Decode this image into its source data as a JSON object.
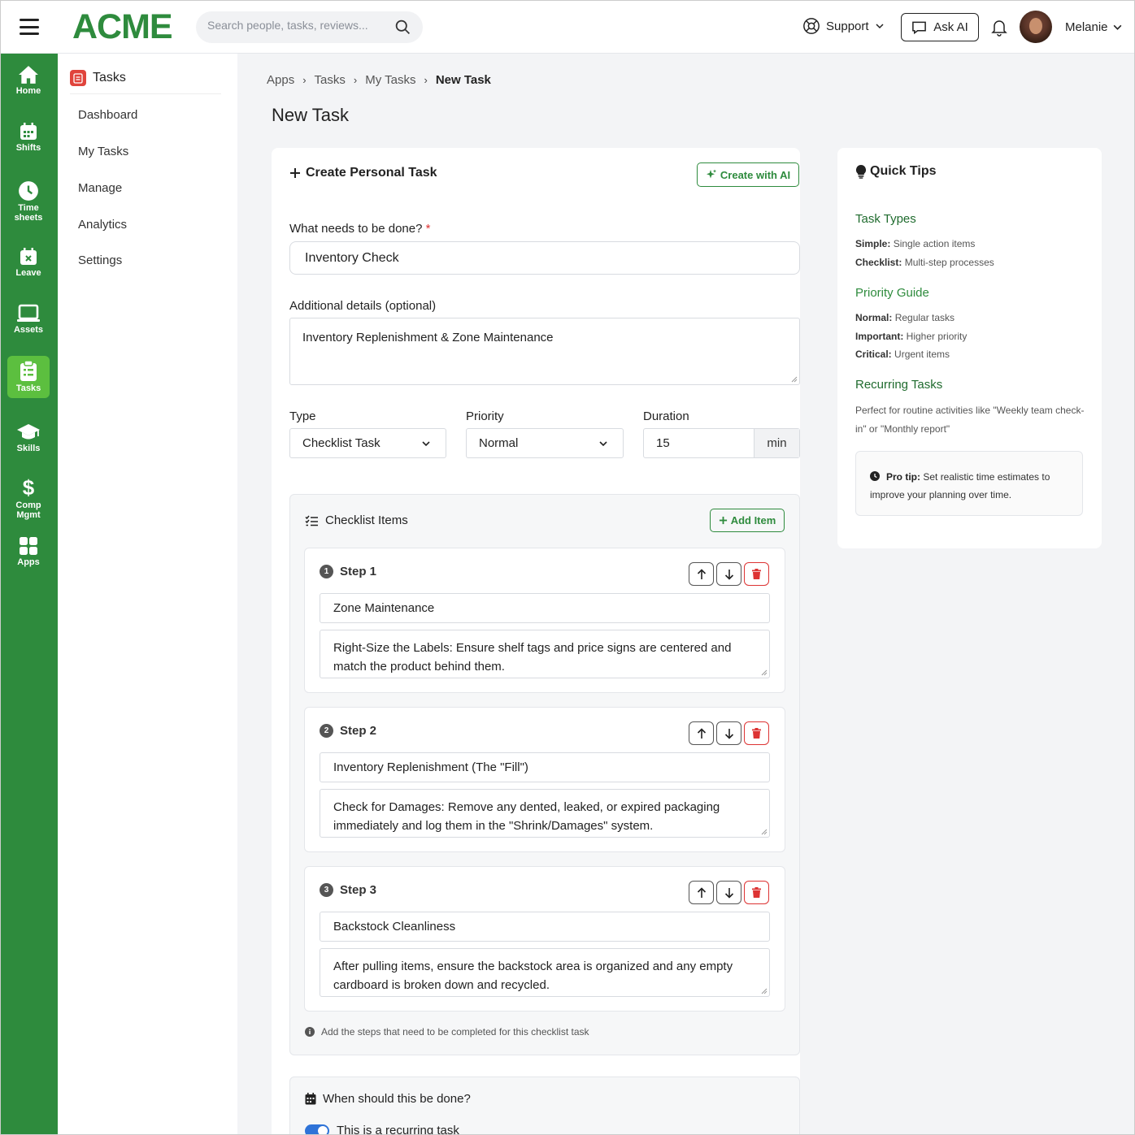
{
  "header": {
    "logo": "ACME",
    "search_placeholder": "Search people, tasks, reviews...",
    "support": "Support",
    "ask_ai": "Ask AI",
    "user_name": "Melanie"
  },
  "rail": {
    "items": [
      {
        "label": "Home"
      },
      {
        "label": "Shifts"
      },
      {
        "label": "Time sheets"
      },
      {
        "label": "Leave"
      },
      {
        "label": "Assets"
      },
      {
        "label": "Tasks"
      },
      {
        "label": "Skills"
      },
      {
        "label": "Comp Mgmt"
      },
      {
        "label": "Apps"
      }
    ],
    "active_color": "#5cbf3f",
    "brand_color": "#2e8b3d"
  },
  "subnav": {
    "title": "Tasks",
    "items": [
      "Dashboard",
      "My Tasks",
      "Manage",
      "Analytics",
      "Settings"
    ]
  },
  "breadcrumb": [
    "Apps",
    "Tasks",
    "My Tasks",
    "New Task"
  ],
  "page_title": "New Task",
  "form": {
    "heading": "Create Personal Task",
    "create_with_ai": "Create with AI",
    "title_label": "What needs to be done?",
    "required_mark": "*",
    "title_value": "Inventory Check",
    "details_label": "Additional details (optional)",
    "details_value": "Inventory Replenishment & Zone Maintenance",
    "type_label": "Type",
    "type_value": "Checklist Task",
    "priority_label": "Priority",
    "priority_value": "Normal",
    "duration_label": "Duration",
    "duration_value": "15",
    "duration_unit": "min"
  },
  "checklist": {
    "heading": "Checklist Items",
    "add_item": "Add Item",
    "steps": [
      {
        "num": "1",
        "label": "Step 1",
        "title": "Zone Maintenance",
        "desc": "Right-Size the Labels: Ensure shelf tags and price signs are centered and match the product behind them."
      },
      {
        "num": "2",
        "label": "Step 2",
        "title": "Inventory Replenishment (The \"Fill\")",
        "desc": "Check for Damages: Remove any dented, leaked, or expired packaging immediately and log them in the \"Shrink/Damages\" system."
      },
      {
        "num": "3",
        "label": "Step 3",
        "title": "Backstock Cleanliness",
        "desc": "After pulling items, ensure the backstock area is organized and any empty cardboard is broken down and recycled."
      }
    ],
    "hint": "Add the steps that need to be completed for this checklist task"
  },
  "schedule": {
    "heading": "When should this be done?",
    "recurring_label": "This is a recurring task",
    "recurring_on": true
  },
  "tips": {
    "heading": "Quick Tips",
    "types_heading": "Task Types",
    "simple_key": "Simple:",
    "simple_val": "Single action items",
    "checklist_key": "Checklist:",
    "checklist_val": "Multi-step processes",
    "priority_heading": "Priority Guide",
    "normal_key": "Normal:",
    "normal_val": "Regular tasks",
    "important_key": "Important:",
    "important_val": "Higher priority",
    "critical_key": "Critical:",
    "critical_val": "Urgent items",
    "recurring_heading": "Recurring Tasks",
    "recurring_text": "Perfect for routine activities like \"Weekly team check-in\" or \"Monthly report\"",
    "protip_key": "Pro tip:",
    "protip_text": "Set realistic time estimates to improve your planning over time."
  }
}
